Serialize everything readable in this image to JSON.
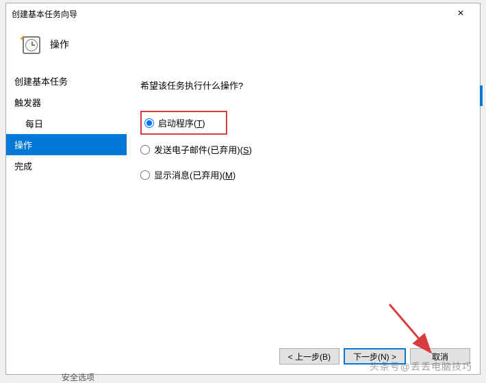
{
  "window": {
    "title": "创建基本任务向导",
    "close": "×"
  },
  "header": {
    "heading": "操作"
  },
  "sidebar": {
    "items": [
      {
        "label": "创建基本任务",
        "sub": false,
        "active": false
      },
      {
        "label": "触发器",
        "sub": false,
        "active": false
      },
      {
        "label": "每日",
        "sub": true,
        "active": false
      },
      {
        "label": "操作",
        "sub": false,
        "active": true
      },
      {
        "label": "完成",
        "sub": false,
        "active": false
      }
    ]
  },
  "content": {
    "prompt": "希望该任务执行什么操作?",
    "options": [
      {
        "label_pre": "启动程序(",
        "accel": "T",
        "label_post": ")",
        "checked": true,
        "highlighted": true
      },
      {
        "label_pre": "发送电子邮件(已弃用)(",
        "accel": "S",
        "label_post": ")",
        "checked": false,
        "highlighted": false
      },
      {
        "label_pre": "显示消息(已弃用)(",
        "accel": "M",
        "label_post": ")",
        "checked": false,
        "highlighted": false
      }
    ]
  },
  "buttons": {
    "back": "< 上一步(B)",
    "next": "下一步(N) >",
    "cancel": "取消"
  },
  "watermark": "头条号@丢丢电脑技巧",
  "stray": "安全选项"
}
